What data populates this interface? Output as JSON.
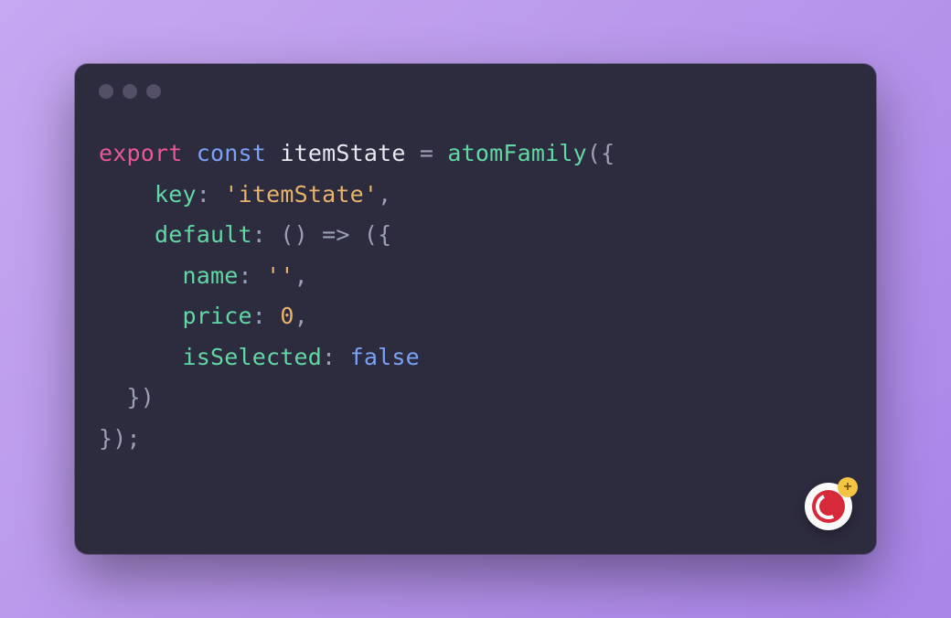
{
  "code": {
    "line1": {
      "export": "export",
      "const": "const",
      "varname": "itemState",
      "equals": "=",
      "func": "atomFamily",
      "open": "({"
    },
    "line2": {
      "indent": "    ",
      "prop": "key",
      "colon": ":",
      "value": "'itemState'",
      "comma": ","
    },
    "line3": {
      "indent": "    ",
      "prop": "default",
      "colon": ":",
      "arrow_l": "()",
      "arrow": "=>",
      "open": "({"
    },
    "line4": {
      "indent": "      ",
      "prop": "name",
      "colon": ":",
      "value": "''",
      "comma": ","
    },
    "line5": {
      "indent": "      ",
      "prop": "price",
      "colon": ":",
      "value": "0",
      "comma": ","
    },
    "line6": {
      "indent": "      ",
      "prop": "isSelected",
      "colon": ":",
      "value": "false"
    },
    "line7": {
      "indent": "  ",
      "close": "})"
    },
    "line8": {
      "close": "});"
    }
  },
  "badge": {
    "plus": "+"
  }
}
